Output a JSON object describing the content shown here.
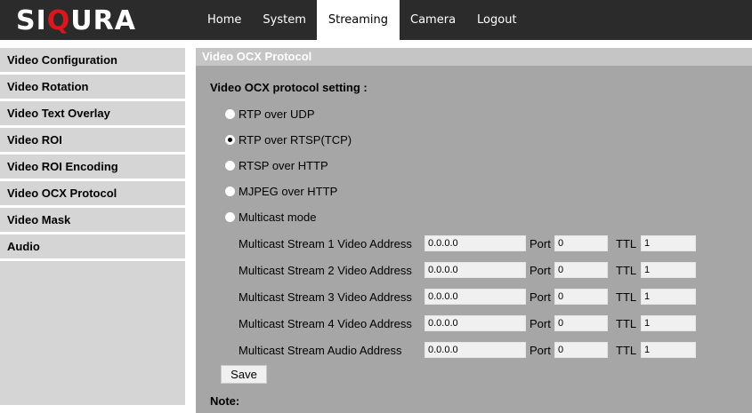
{
  "brand": {
    "logo_prefix": "SI",
    "logo_accent": "Q",
    "logo_suffix": "URA",
    "accent_color": "#e0151b"
  },
  "nav": {
    "tabs": [
      {
        "label": "Home"
      },
      {
        "label": "System"
      },
      {
        "label": "Streaming",
        "active": true
      },
      {
        "label": "Camera"
      },
      {
        "label": "Logout"
      }
    ]
  },
  "sidebar": {
    "items": [
      {
        "label": "Video Configuration"
      },
      {
        "label": "Video Rotation"
      },
      {
        "label": "Video Text Overlay"
      },
      {
        "label": "Video ROI"
      },
      {
        "label": "Video ROI Encoding"
      },
      {
        "label": "Video OCX Protocol"
      },
      {
        "label": "Video Mask"
      },
      {
        "label": "Audio"
      }
    ]
  },
  "main": {
    "title": "Video OCX Protocol",
    "setting_title": "Video OCX protocol setting :",
    "options": [
      {
        "label": "RTP over UDP",
        "checked": false
      },
      {
        "label": "RTP over RTSP(TCP)",
        "checked": true
      },
      {
        "label": "RTSP over HTTP",
        "checked": false
      },
      {
        "label": "MJPEG over HTTP",
        "checked": false
      },
      {
        "label": "Multicast mode",
        "checked": false
      }
    ],
    "port_label": "Port",
    "ttl_label": "TTL",
    "multicast": [
      {
        "label": "Multicast Stream 1 Video Address",
        "address": "0.0.0.0",
        "port": "0",
        "ttl": "1"
      },
      {
        "label": "Multicast Stream 2 Video Address",
        "address": "0.0.0.0",
        "port": "0",
        "ttl": "1"
      },
      {
        "label": "Multicast Stream 3 Video Address",
        "address": "0.0.0.0",
        "port": "0",
        "ttl": "1"
      },
      {
        "label": "Multicast Stream 4 Video Address",
        "address": "0.0.0.0",
        "port": "0",
        "ttl": "1"
      },
      {
        "label": "Multicast Stream Audio Address",
        "address": "0.0.0.0",
        "port": "0",
        "ttl": "1"
      }
    ],
    "save_label": "Save",
    "note_label": "Note:"
  }
}
